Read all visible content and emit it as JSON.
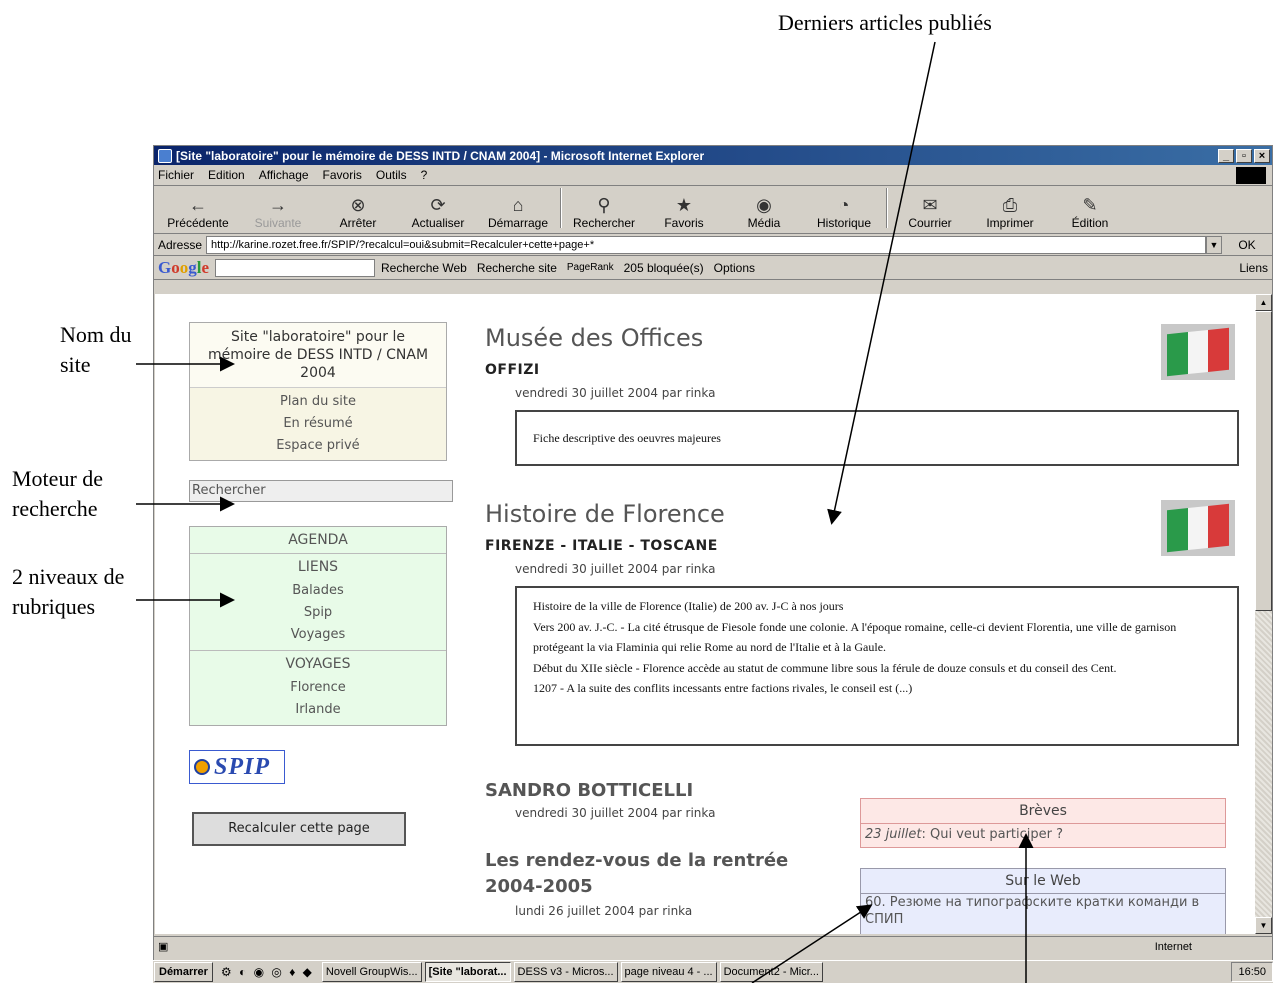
{
  "annotations": {
    "top": "Derniers articles publiés",
    "site_name": [
      "Nom du",
      "site"
    ],
    "search_engine": [
      "Moteur de",
      "recherche"
    ],
    "sections": [
      "2 niveaux de",
      "rubriques"
    ]
  },
  "window": {
    "title": "[Site \"laboratoire\" pour le mémoire de DESS INTD / CNAM 2004] - Microsoft Internet Explorer",
    "buttons": [
      "_",
      "▫",
      "×"
    ]
  },
  "menu": [
    "Fichier",
    "Edition",
    "Affichage",
    "Favoris",
    "Outils",
    "?"
  ],
  "toolbar": [
    {
      "label": "Précédente",
      "icon": "←"
    },
    {
      "label": "Suivante",
      "icon": "→"
    },
    {
      "label": "Arrêter",
      "icon": "⊗"
    },
    {
      "label": "Actualiser",
      "icon": "⟳"
    },
    {
      "label": "Démarrage",
      "icon": "⌂"
    },
    {
      "label": "Rechercher",
      "icon": "⚲"
    },
    {
      "label": "Favoris",
      "icon": "★"
    },
    {
      "label": "Média",
      "icon": "◉"
    },
    {
      "label": "Historique",
      "icon": "◔"
    },
    {
      "label": "Courrier",
      "icon": "✉"
    },
    {
      "label": "Imprimer",
      "icon": "⎙"
    },
    {
      "label": "Édition",
      "icon": "✎"
    }
  ],
  "address": {
    "label": "Adresse",
    "url": "http://karine.rozet.free.fr/SPIP/?recalcul=oui&submit=Recalculer+cette+page+*",
    "go": "OK"
  },
  "googlebar": {
    "search_web": "Recherche Web",
    "search_site": "Recherche site",
    "pagerank": "PageRank",
    "blocked": "205 bloquée(s)",
    "options": "Options",
    "links": "Liens"
  },
  "site": {
    "name": "Site \"laboratoire\" pour le mémoire de DESS INTD / CNAM 2004",
    "nav": [
      "Plan du site",
      "En résumé",
      "Espace privé"
    ],
    "search_placeholder": "Rechercher",
    "rubriques": [
      {
        "title": "AGENDA",
        "subs": []
      },
      {
        "title": "LIENS",
        "subs": [
          "Balades",
          "Spip",
          "Voyages"
        ]
      },
      {
        "title": "VOYAGES",
        "subs": [
          "Florence",
          "Irlande"
        ]
      }
    ],
    "spip_logo": "SPIP",
    "recalc": "Recalculer cette page"
  },
  "articles": [
    {
      "title": "Musée des Offices",
      "subtitle": "OFFIZI",
      "date": "vendredi 30 juillet 2004 par rinka",
      "body": [
        "Fiche descriptive des oeuvres majeures"
      ]
    },
    {
      "title": "Histoire de Florence",
      "subtitle": "FIRENZE - ITALIE - TOSCANE",
      "date": "vendredi 30 juillet 2004 par rinka",
      "body": [
        "Histoire de la ville de Florence (Italie) de 200 av. J-C à nos jours",
        "Vers 200 av. J.-C. - La cité étrusque de Fiesole fonde une colonie. A l'époque romaine, celle-ci devient Florentia, une ville de garnison protégeant la via Flaminia qui relie Rome au nord de l'Italie et à la Gaule.",
        "Début du XIIe siècle - Florence accède au statut de commune libre sous la férule de douze consuls et du conseil des Cent.",
        "1207 - A la suite des conflits incessants entre factions rivales, le conseil est (...)"
      ]
    }
  ],
  "other_articles": [
    {
      "title": "SANDRO BOTTICELLI",
      "date": "vendredi 30 juillet 2004 par rinka"
    },
    {
      "title": "Les rendez-vous de la rentrée 2004-2005",
      "date": "lundi 26 juillet 2004 par rinka"
    }
  ],
  "breves": {
    "title": "Brèves",
    "items": [
      {
        "date": "23 juillet",
        "text": ": Qui veut participer ?"
      }
    ]
  },
  "web": {
    "title": "Sur le Web",
    "items": [
      "60. Резюме на типографските кратки команди в СПИП"
    ]
  },
  "statusbar": {
    "zone": "Internet"
  },
  "taskbar": {
    "start": "Démarrer",
    "tasks": [
      "Novell GroupWis...",
      "[Site \"laborat...",
      "DESS v3 - Micros...",
      "page niveau 4 - ...",
      "Document2 - Micr..."
    ],
    "clock": "16:50"
  },
  "colors": {
    "flag_green": "#2a9a4a",
    "flag_white": "#f4f4f4",
    "flag_red": "#d83a3a"
  }
}
